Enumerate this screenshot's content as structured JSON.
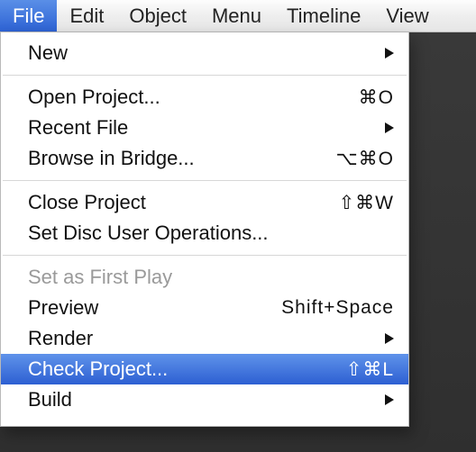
{
  "menubar": {
    "items": [
      {
        "label": "File",
        "selected": true
      },
      {
        "label": "Edit",
        "selected": false
      },
      {
        "label": "Object",
        "selected": false
      },
      {
        "label": "Menu",
        "selected": false
      },
      {
        "label": "Timeline",
        "selected": false
      },
      {
        "label": "View",
        "selected": false
      }
    ]
  },
  "file_menu": {
    "new": {
      "label": "New"
    },
    "open_project": {
      "label": "Open Project...",
      "shortcut": "⌘O"
    },
    "recent_file": {
      "label": "Recent File"
    },
    "browse_bridge": {
      "label": "Browse in Bridge...",
      "shortcut": "⌥⌘O"
    },
    "close_project": {
      "label": "Close Project",
      "shortcut": "⇧⌘W"
    },
    "set_disc_ops": {
      "label": "Set Disc User Operations..."
    },
    "set_first_play": {
      "label": "Set as First Play"
    },
    "preview": {
      "label": "Preview",
      "shortcut": "Shift+Space"
    },
    "render": {
      "label": "Render"
    },
    "check_project": {
      "label": "Check Project...",
      "shortcut": "⇧⌘L"
    },
    "build": {
      "label": "Build"
    }
  }
}
